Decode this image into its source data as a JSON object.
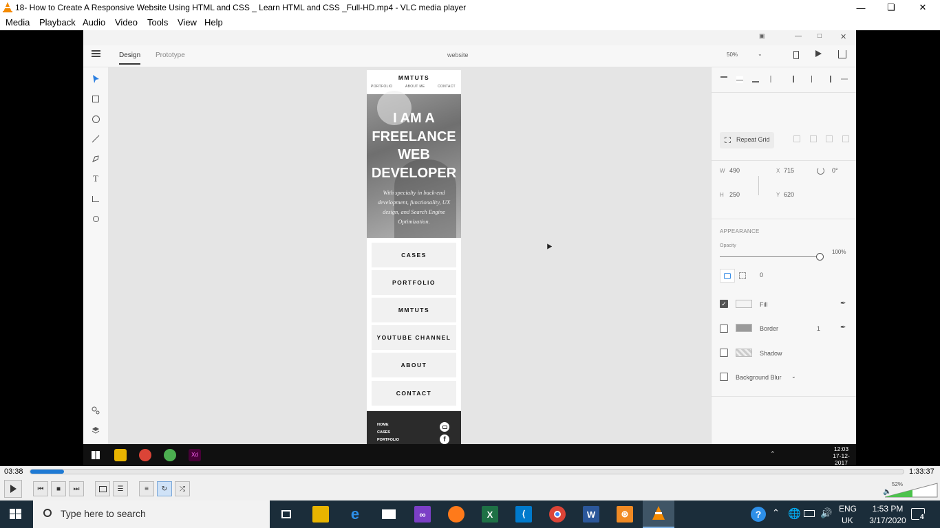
{
  "window": {
    "title": "18- How to Create A Responsive Website Using HTML and CSS  _ Learn HTML and CSS _Full-HD.mp4 - VLC media player"
  },
  "menu": [
    "Media",
    "Playback",
    "Audio",
    "Video",
    "Tools",
    "View",
    "Help"
  ],
  "xd": {
    "tabs": {
      "design": "Design",
      "prototype": "Prototype"
    },
    "doc_title": "website",
    "zoom": "50%",
    "artboard": {
      "brand": "MMTUTS",
      "nav": [
        "PORTFOLIO",
        "ABOUT ME",
        "CONTACT"
      ],
      "hero_lines": [
        "I AM A",
        "FREELANCE",
        "WEB",
        "DEVELOPER"
      ],
      "hero_sub": [
        "With specialty in back-end",
        "development, functionality, UX",
        "design, and Search Engine",
        "Optimization."
      ],
      "buttons": [
        "CASES",
        "PORTFOLIO",
        "MMTUTS",
        "YOUTUBE CHANNEL",
        "ABOUT",
        "CONTACT"
      ],
      "footer_links": [
        "HOME",
        "CASES",
        "PORTFOLIO"
      ]
    },
    "panel": {
      "repeat_grid": "Repeat Grid",
      "w_label": "W",
      "w": "490",
      "h_label": "H",
      "h": "250",
      "x_label": "X",
      "x": "715",
      "y_label": "Y",
      "y": "620",
      "rotation": "0°",
      "appearance": "APPEARANCE",
      "opacity_label": "Opacity",
      "opacity": "100%",
      "radius": "0",
      "fill": "Fill",
      "border": "Border",
      "border_width": "1",
      "shadow": "Shadow",
      "bg_blur": "Background Blur",
      "fill_checked": true
    },
    "video_clock": {
      "time": "12:03",
      "date": "17-12-2017"
    }
  },
  "player": {
    "elapsed": "03:38",
    "total": "1:33:37",
    "progress": 0.039,
    "volume": "52%"
  },
  "taskbar": {
    "search_placeholder": "Type here to search",
    "lang": "ENG",
    "region": "UK",
    "time": "1:53 PM",
    "date": "3/17/2020",
    "notifications": "4"
  },
  "colors": {
    "accent": "#1e7ad4",
    "vlc_orange": "#f48a00",
    "taskbar": "#1b2d3a"
  }
}
